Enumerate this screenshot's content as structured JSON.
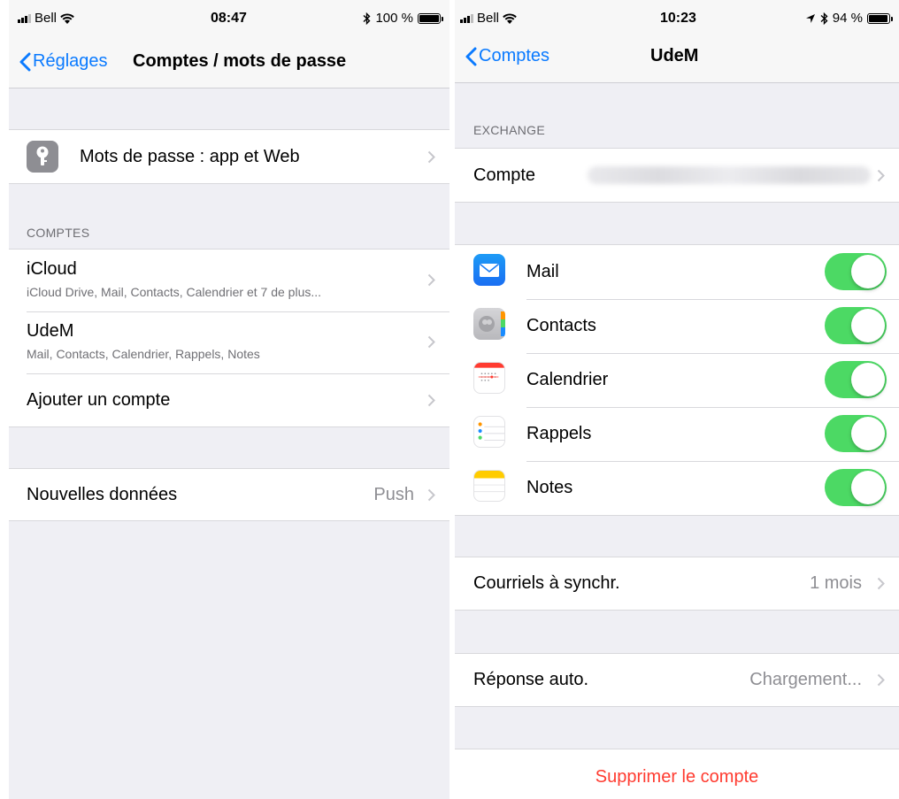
{
  "left": {
    "status": {
      "carrier": "Bell",
      "time": "08:47",
      "battery_text": "100 %",
      "battery_level": 1.0
    },
    "nav": {
      "back_label": "Réglages",
      "title": "Comptes / mots de passe"
    },
    "passwords_row": {
      "label": "Mots de passe : app et Web",
      "icon": "key-icon"
    },
    "accounts_header": "COMPTES",
    "accounts": [
      {
        "title": "iCloud",
        "subtitle": "iCloud Drive, Mail, Contacts, Calendrier et 7 de plus..."
      },
      {
        "title": "UdeM",
        "subtitle": "Mail, Contacts, Calendrier, Rappels, Notes"
      },
      {
        "title": "Ajouter un compte"
      }
    ],
    "fetch_row": {
      "label": "Nouvelles données",
      "value": "Push"
    }
  },
  "right": {
    "status": {
      "carrier": "Bell",
      "time": "10:23",
      "battery_text": "94 %",
      "battery_level": 0.94
    },
    "nav": {
      "back_label": "Comptes",
      "title": "UdeM"
    },
    "exchange_header": "EXCHANGE",
    "account_row": {
      "label": "Compte"
    },
    "services": [
      {
        "label": "Mail",
        "icon": "mail-icon",
        "enabled": true
      },
      {
        "label": "Contacts",
        "icon": "contacts-icon",
        "enabled": true
      },
      {
        "label": "Calendrier",
        "icon": "calendar-icon",
        "enabled": true
      },
      {
        "label": "Rappels",
        "icon": "reminders-icon",
        "enabled": true
      },
      {
        "label": "Notes",
        "icon": "notes-icon",
        "enabled": true
      }
    ],
    "sync_row": {
      "label": "Courriels à synchr.",
      "value": "1 mois"
    },
    "auto_reply_row": {
      "label": "Réponse auto.",
      "value": "Chargement..."
    },
    "delete_label": "Supprimer le compte"
  },
  "colors": {
    "accent": "#0a7aff",
    "toggle_on": "#4cd964",
    "destructive": "#ff3b30",
    "background": "#efeff4"
  }
}
